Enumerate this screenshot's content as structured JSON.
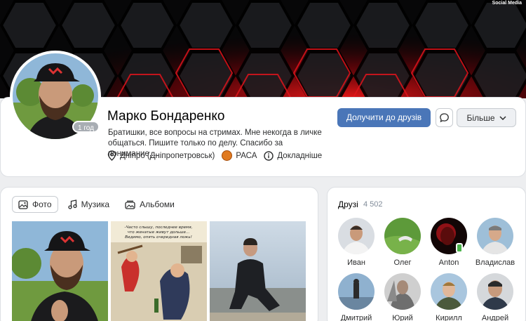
{
  "watermark": "Social Media",
  "profile": {
    "name": "Марко Бондаренко",
    "online": "1 год",
    "status_line1": "Братишки, все вопросы на стримах. Мне некогда в личке",
    "status_line2": "общаться. Пишите только по делу. Спасибо за понимание,...",
    "city": "Дніпро (Дніпропетровськ)",
    "university": "РАСА",
    "details": "Докладніше",
    "add_friend": "Долучити до друзів",
    "more": "Більше"
  },
  "tabs": [
    {
      "label": "Фото",
      "icon": "photo-icon",
      "active": true
    },
    {
      "label": "Музика",
      "icon": "music-icon",
      "active": false
    },
    {
      "label": "Альбоми",
      "icon": "album-icon",
      "active": false
    }
  ],
  "photos": [
    {
      "description_icon": "selfie-photo"
    },
    {
      "caption_line1": "-Часто слышу, последнее время,",
      "caption_line2": "что женатые живут дольше...",
      "caption_line3": "Видимо, опять очередная ложь!"
    },
    {
      "description_icon": "man-by-sea-photo"
    }
  ],
  "friends": {
    "title": "Друзі",
    "count": "4 502",
    "items": [
      {
        "name": "Иван"
      },
      {
        "name": "Олег"
      },
      {
        "name": "Anton"
      },
      {
        "name": "Владислав"
      },
      {
        "name": "Дмитрий"
      },
      {
        "name": "Юрий"
      },
      {
        "name": "Кирилл"
      },
      {
        "name": "Андрей"
      }
    ]
  },
  "colors": {
    "accent": "#4a76b8",
    "cover_glow": "#e0141c",
    "background": "#edeef0"
  }
}
